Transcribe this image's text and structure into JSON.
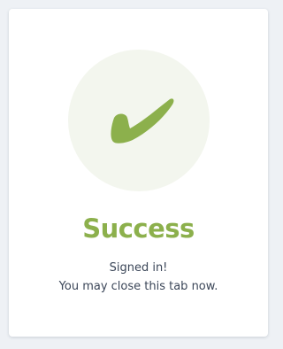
{
  "card": {
    "title": "Success",
    "message_line1": "Signed in!",
    "message_line2": "You may close this tab now."
  },
  "icons": {
    "status": "checkmark-icon"
  },
  "colors": {
    "accent": "#8cb04c",
    "circle_bg": "#f3f6ee",
    "page_bg": "#eef1f5",
    "text": "#3b4658"
  }
}
